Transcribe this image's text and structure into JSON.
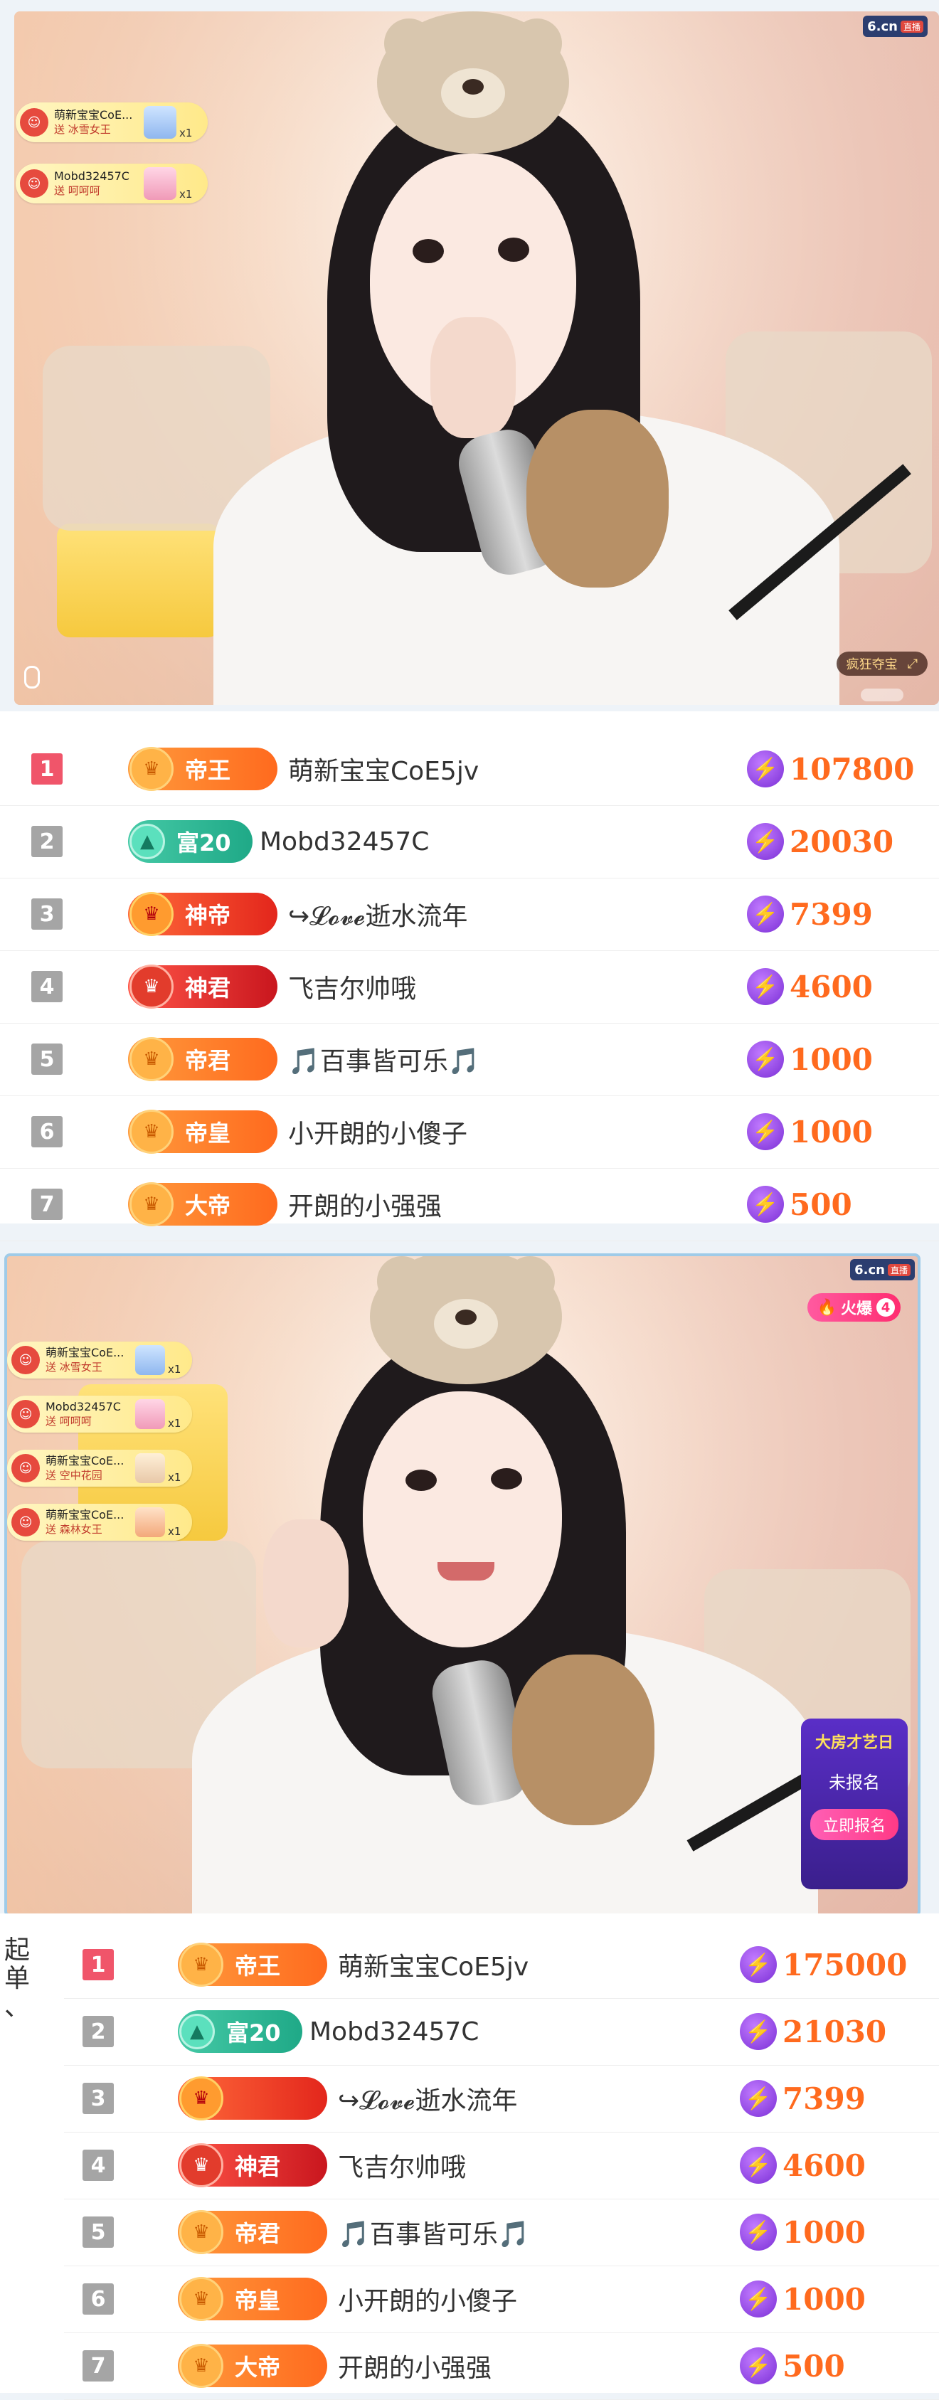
{
  "stream1": {
    "logo": "6.cn",
    "logo_tag": "直播",
    "gifts": [
      {
        "user": "萌新宝宝CoE...",
        "action": "送 冰雪女王",
        "count": "x1"
      },
      {
        "user": "Mobd32457C",
        "action": "送 呵呵呵",
        "count": "x1"
      }
    ],
    "corner_pill": "疯狂夺宝",
    "expand_icon": "⤢"
  },
  "ranking1": [
    {
      "rank": "1",
      "badge": "帝王",
      "badge_style": "orange",
      "name": "萌新宝宝CoE5jv",
      "score": "107800"
    },
    {
      "rank": "2",
      "badge": "富20",
      "badge_style": "green",
      "name": "Mobd32457C",
      "score": "20030"
    },
    {
      "rank": "3",
      "badge": "神帝",
      "badge_style": "red",
      "name": "↪𝓛𝓸𝓿𝓮逝水流年",
      "score": "7399"
    },
    {
      "rank": "4",
      "badge": "神君",
      "badge_style": "red2",
      "name": "飞吉尔帅哦",
      "score": "4600"
    },
    {
      "rank": "5",
      "badge": "帝君",
      "badge_style": "orange",
      "name": "🎵百事皆可乐🎵",
      "score": "1000"
    },
    {
      "rank": "6",
      "badge": "帝皇",
      "badge_style": "orange",
      "name": "小开朗的小傻子",
      "score": "1000"
    },
    {
      "rank": "7",
      "badge": "大帝",
      "badge_style": "orange",
      "name": "开朗的小强强",
      "score": "500"
    }
  ],
  "stream2": {
    "logo": "6.cn",
    "logo_tag": "直播",
    "fire_label": "火爆",
    "fire_count": "4",
    "gifts": [
      {
        "user": "萌新宝宝CoE...",
        "action": "送 冰雪女王",
        "count": "x1"
      },
      {
        "user": "Mobd32457C",
        "action": "送 呵呵呵",
        "count": "x1"
      },
      {
        "user": "萌新宝宝CoE...",
        "action": "送 空中花园",
        "count": "x1"
      },
      {
        "user": "萌新宝宝CoE...",
        "action": "送 森林女王",
        "count": "x1"
      }
    ],
    "event": {
      "title": "大房才艺日",
      "status": "未报名",
      "button": "立即报名"
    }
  },
  "side_text": "起\n单\n、",
  "ranking2": [
    {
      "rank": "1",
      "badge": "帝王",
      "badge_style": "orange",
      "name": "萌新宝宝CoE5jv",
      "score": "175000"
    },
    {
      "rank": "2",
      "badge": "富20",
      "badge_style": "green",
      "name": "Mobd32457C",
      "score": "21030"
    },
    {
      "rank": "3",
      "badge": "",
      "badge_style": "red",
      "name": "↪𝓛𝓸𝓿𝓮逝水流年",
      "score": "7399"
    },
    {
      "rank": "4",
      "badge": "神君",
      "badge_style": "red2",
      "name": "飞吉尔帅哦",
      "score": "4600"
    },
    {
      "rank": "5",
      "badge": "帝君",
      "badge_style": "orange",
      "name": "🎵百事皆可乐🎵",
      "score": "1000"
    },
    {
      "rank": "6",
      "badge": "帝皇",
      "badge_style": "orange",
      "name": "小开朗的小傻子",
      "score": "1000"
    },
    {
      "rank": "7",
      "badge": "大帝",
      "badge_style": "orange",
      "name": "开朗的小强强",
      "score": "500"
    }
  ]
}
